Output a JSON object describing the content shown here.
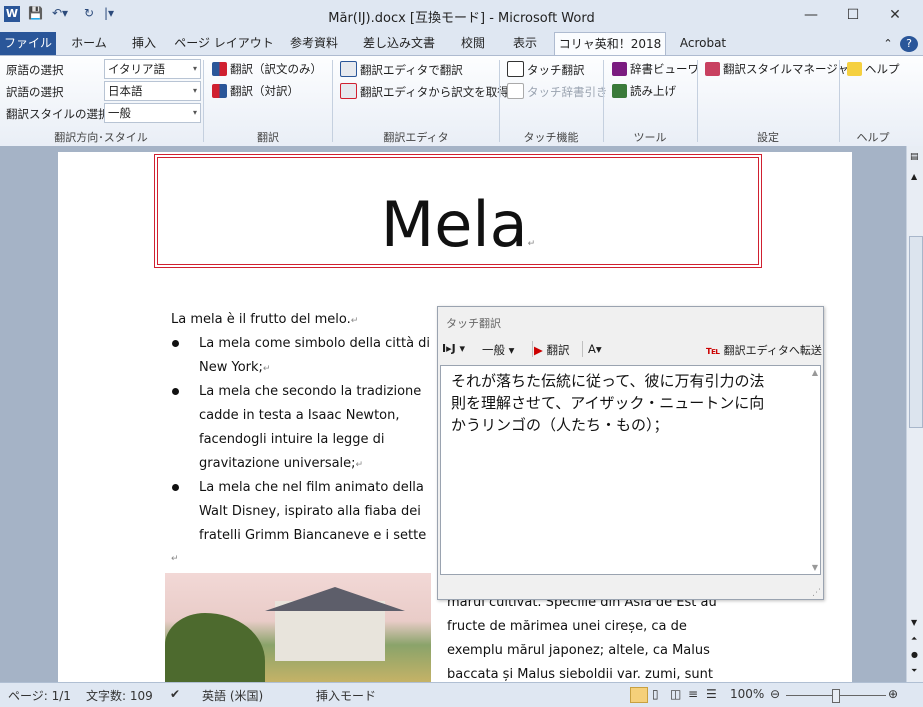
{
  "window": {
    "title": "Măr(IJ).docx [互換モード] - Microsoft Word"
  },
  "tabs": {
    "file": "ファイル",
    "home": "ホーム",
    "insert": "挿入",
    "page_layout": "ページ レイアウト",
    "references": "参考資料",
    "mailings": "差し込み文書",
    "review": "校閲",
    "view": "表示",
    "korya": "コリャ英和！2018",
    "acrobat": "Acrobat"
  },
  "ribbon": {
    "source_lang_label": "原語の選択",
    "source_lang_value": "イタリア語",
    "target_lang_label": "訳語の選択",
    "target_lang_value": "日本語",
    "style_label": "翻訳スタイルの選択",
    "style_value": "一般",
    "translate_only": "翻訳（訳文のみ）",
    "translate_pair": "翻訳（対訳）",
    "editor_translate": "翻訳エディタで翻訳",
    "editor_get": "翻訳エディタから訳文を取得",
    "touch_translate": "タッチ翻訳",
    "touch_dict": "タッチ辞書引き",
    "dict_viewer": "辞書ビューワ",
    "read_aloud": "読み上げ",
    "style_manager": "翻訳スタイルマネージャ",
    "help": "ヘルプ",
    "groups": {
      "direction": "翻訳方向･スタイル",
      "translate": "翻訳",
      "editor": "翻訳エディタ",
      "touch": "タッチ機能",
      "tools": "ツール",
      "settings": "設定",
      "help": "ヘルプ"
    }
  },
  "document": {
    "title": "Mela",
    "line1": "La mela è il frutto del melo.",
    "b1_l1": "La mela come simbolo della città di",
    "b1_l2": "New York;",
    "b2_l1": "La mela che secondo la tradizione",
    "b2_l2": "cadde in testa a Isaac Newton,",
    "b2_l3": "facendogli intuire la legge di",
    "b2_l4": "gravitazione universale;",
    "b3_l1": "La mela che nel film animato della",
    "b3_l2": "Walt Disney, ispirato alla fiaba dei",
    "b3_l3": "fratelli Grimm Biancaneve e i sette",
    "ro1": "mărul cultivat. Speciile din Asia de Est au",
    "ro2": "fructe de mărimea unei cireșe, ca de",
    "ro3": "exemplu mărul japonez; altele, ca Malus",
    "ro4": "baccata și Malus sieboldii var. zumi, sunt"
  },
  "popup": {
    "title": "タッチ翻訳",
    "lang_pair": "I▸J",
    "style": "一般",
    "translate": "翻訳",
    "send_editor": "翻訳エディタへ転送",
    "result_l1": "それが落ちた伝統に従って、彼に万有引力の法",
    "result_l2": "則を理解させて、アイザック・ニュートンに向",
    "result_l3": "かうリンゴの（人たち・もの）；"
  },
  "status": {
    "page": "ページ: 1/1",
    "words": "文字数: 109",
    "language": "英語 (米国)",
    "mode": "挿入モード",
    "zoom": "100%"
  }
}
